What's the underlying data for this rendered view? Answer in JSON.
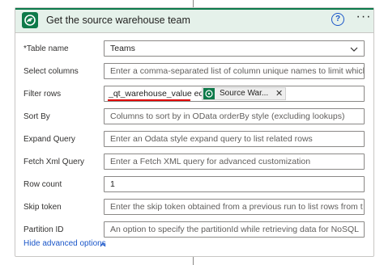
{
  "action": {
    "title": "Get the source warehouse team"
  },
  "fields": [
    {
      "label": "Table name",
      "required_mark": "*",
      "value": "Teams"
    },
    {
      "label": "Select columns",
      "placeholder": "Enter a comma-separated list of column unique names to limit which"
    },
    {
      "label": "Filter rows",
      "value_text": "_qt_warehouse_value eq",
      "token_label": "Source War..."
    },
    {
      "label": "Sort By",
      "placeholder": "Columns to sort by in OData orderBy style (excluding lookups)"
    },
    {
      "label": "Expand Query",
      "placeholder": "Enter an Odata style expand query to list related rows"
    },
    {
      "label": "Fetch Xml Query",
      "placeholder": "Enter a Fetch XML query for advanced customization"
    },
    {
      "label": "Row count",
      "value": "1"
    },
    {
      "label": "Skip token",
      "placeholder": "Enter the skip token obtained from a previous run to list rows from t"
    },
    {
      "label": "Partition ID",
      "placeholder": "An option to specify the partitionId while retrieving data for NoSQL"
    }
  ],
  "advanced_toggle": "Hide advanced options",
  "colors": {
    "header_bg": "#e5f1ea",
    "accent": "#0b7a4b",
    "link": "#1a56c9",
    "highlight": "#e00000"
  },
  "icons": {
    "logo": "dataverse-logo-icon",
    "help": "help-icon",
    "more": "more-options-icon",
    "dropdown": "chevron-down-icon",
    "token_logo": "dataverse-logo-icon",
    "token_remove": "close-icon",
    "toggle": "chevron-up-icon"
  }
}
